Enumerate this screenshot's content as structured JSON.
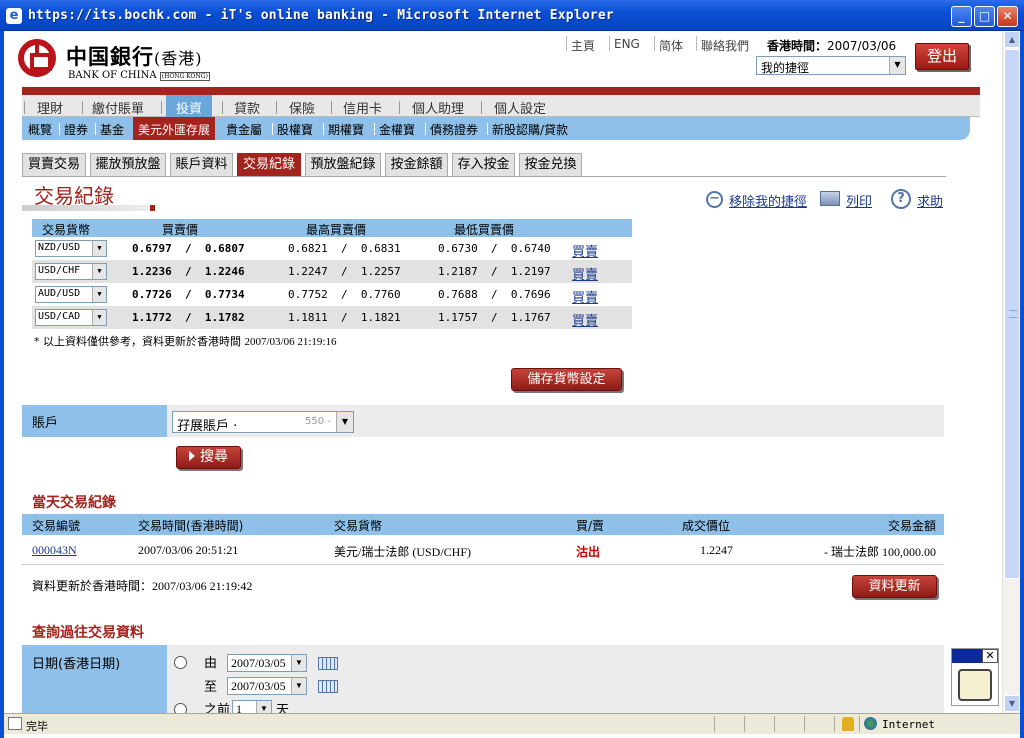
{
  "window": {
    "title": "https://its.bochk.com - iT's online banking - Microsoft Internet Explorer",
    "icon": "ie-icon"
  },
  "status": {
    "text": "完毕",
    "zone": "Internet"
  },
  "header": {
    "logo_cn": "中国銀行",
    "logo_cn_suffix": "(香港)",
    "logo_en": "BANK OF CHINA",
    "logo_en_suffix": "(HONG KONG)",
    "links": [
      "主頁",
      "ENG",
      "简体",
      "聯絡我們"
    ],
    "hk_time_label": "香港時間：",
    "hk_time_value": "2007/03/06",
    "shortcut": "我的捷徑",
    "logout": "登出"
  },
  "nav": {
    "items": [
      "理財",
      "繳付賬單",
      "投資",
      "貸款",
      "保險",
      "信用卡",
      "個人助理",
      "個人設定"
    ],
    "active": "投資"
  },
  "subnav": {
    "items": [
      "概覽",
      "證券",
      "基金",
      "美元外匯存展",
      "貴金屬",
      "股權寶",
      "期權寶",
      "金權寶",
      "債務證券",
      "新股認購/貸款"
    ],
    "active": "美元外匯存展"
  },
  "tabs": {
    "items": [
      "買賣交易",
      "擺放預放盤",
      "賬戶資料",
      "交易紀錄",
      "預放盤紀錄",
      "按金餘額",
      "存入按金",
      "按金兑換"
    ],
    "active": "交易紀錄"
  },
  "page": {
    "title": "交易紀錄",
    "actions": {
      "remove_shortcut": "移除我的捷徑",
      "print": "列印",
      "help": "求助"
    }
  },
  "fx_table": {
    "headers": [
      "交易貨幣",
      "買賣價",
      "最高買賣價",
      "最低買賣價"
    ],
    "rows": [
      {
        "pair": "NZD/USD",
        "bid": "0.6797",
        "ask": "0.6807",
        "high_bid": "0.6821",
        "high_ask": "0.6831",
        "low_bid": "0.6730",
        "low_ask": "0.6740",
        "link": "買賣"
      },
      {
        "pair": "USD/CHF",
        "bid": "1.2236",
        "ask": "1.2246",
        "high_bid": "1.2247",
        "high_ask": "1.2257",
        "low_bid": "1.2187",
        "low_ask": "1.2197",
        "link": "買賣"
      },
      {
        "pair": "AUD/USD",
        "bid": "0.7726",
        "ask": "0.7734",
        "high_bid": "0.7752",
        "high_ask": "0.7760",
        "low_bid": "0.7688",
        "low_ask": "0.7696",
        "link": "買賣"
      },
      {
        "pair": "USD/CAD",
        "bid": "1.1772",
        "ask": "1.1782",
        "high_bid": "1.1811",
        "high_ask": "1.1821",
        "low_bid": "1.1757",
        "low_ask": "1.1767",
        "link": "買賣"
      }
    ],
    "note": "* 以上資料僅供參考，資料更新於香港時間",
    "note_time": "2007/03/06 21:19:16",
    "save_button": "儲存貨幣設定"
  },
  "account": {
    "label": "賬戶",
    "value": "孖展賬戶 ·",
    "value_tail": "550 -",
    "search_button": "搜尋"
  },
  "today": {
    "title": "當天交易紀錄",
    "headers": [
      "交易編號",
      "交易時間(香港時間)",
      "交易貨幣",
      "買/賣",
      "成交價位",
      "交易金額"
    ],
    "rows": [
      {
        "id": "000043N",
        "time": "2007/03/06 20:51:21",
        "pair": "美元/瑞士法郎 (USD/CHF)",
        "side": "沽出",
        "price": "1.2247",
        "amount": "- 瑞士法郎 100,000.00"
      }
    ],
    "update_label": "資料更新於香港時間：",
    "update_time": "2007/03/06 21:19:42",
    "refresh_button": "資料更新"
  },
  "history": {
    "title": "查詢過往交易資料",
    "date_label": "日期(香港日期)",
    "from_label": "由",
    "to_label": "至",
    "from_value": "2007/03/05",
    "to_value": "2007/03/05",
    "before_label": "之前",
    "before_value": "1",
    "days_label": "天"
  }
}
